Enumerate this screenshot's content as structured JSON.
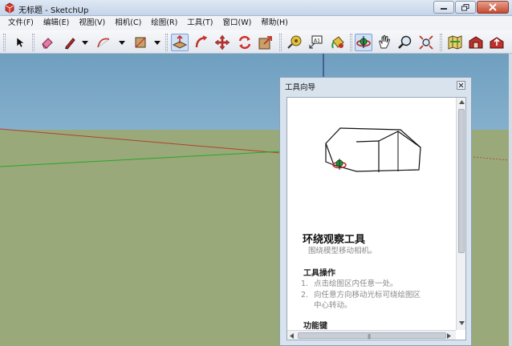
{
  "window": {
    "title": "无标题 - SketchUp"
  },
  "menu": {
    "items": [
      "文件(F)",
      "编辑(E)",
      "视图(V)",
      "相机(C)",
      "绘图(R)",
      "工具(T)",
      "窗口(W)",
      "帮助(H)"
    ]
  },
  "toolbar": {
    "icons": [
      "select-icon",
      "eraser-icon",
      "pencil-icon",
      "arc-icon",
      "rectangle-icon",
      "push-pull-icon",
      "follow-me-icon",
      "move-icon",
      "rotate-icon",
      "scale-icon",
      "tape-measure-icon",
      "text-label-icon",
      "paint-bucket-icon",
      "orbit-icon",
      "pan-icon",
      "zoom-icon",
      "zoom-extents-icon",
      "map-icon",
      "warehouse-icon",
      "share-icon"
    ]
  },
  "colors": {
    "sky_top": "#6f9fc0",
    "sky_bottom": "#c6dbe8",
    "ground": "#9aa97a",
    "red_axis": "#b3402e",
    "green_axis": "#2aa52a",
    "blue_axis": "#1a1a6a"
  },
  "panel": {
    "title": "工具向导",
    "tool_title": "环绕观察工具",
    "tool_subtitle": "围绕模型移动相机。",
    "operations_title": "工具操作",
    "steps": [
      {
        "num": "1.",
        "text": "点击绘图区内任意一处。"
      },
      {
        "num": "2.",
        "text": "向任意方向移动光标可绕绘图区",
        "cont": "中心转动。"
      }
    ],
    "function_keys_title": "功能键"
  }
}
